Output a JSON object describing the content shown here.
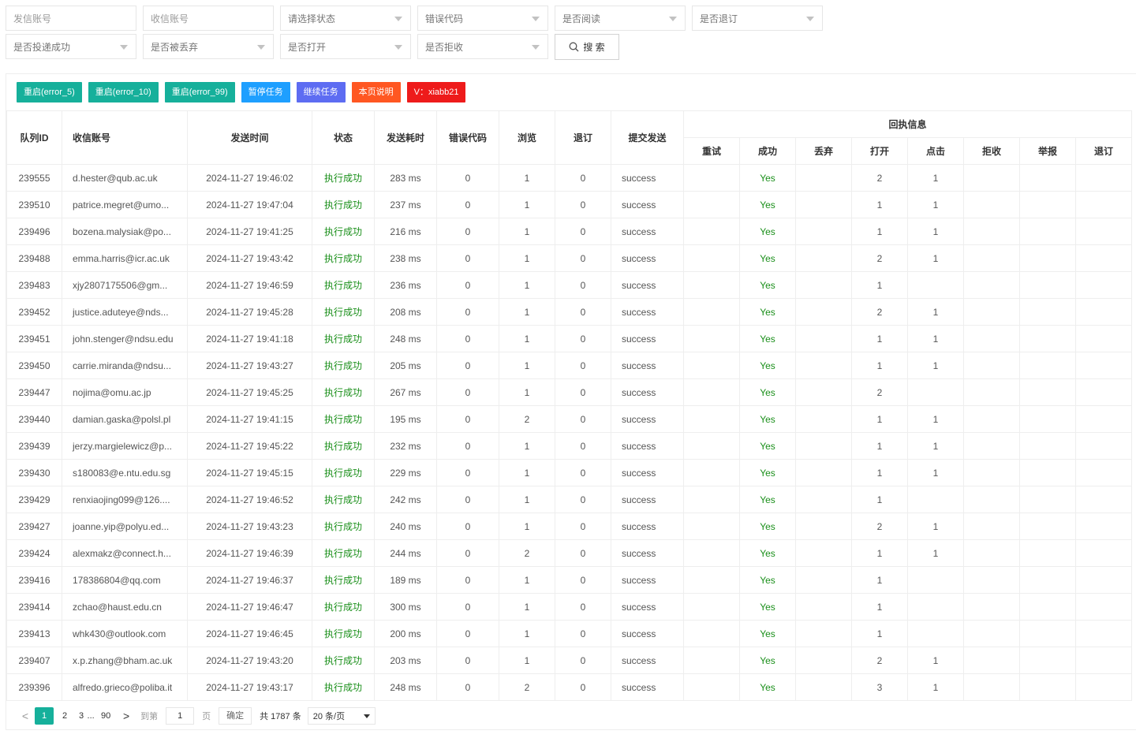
{
  "filters": {
    "row1": [
      {
        "name": "sender-account-input",
        "label": "发信账号",
        "type": "input"
      },
      {
        "name": "recipient-account-input",
        "label": "收信账号",
        "type": "input"
      },
      {
        "name": "status-select",
        "label": "请选择状态",
        "type": "select"
      },
      {
        "name": "error-code-select",
        "label": "错误代码",
        "type": "select"
      },
      {
        "name": "read-select",
        "label": "是否阅读",
        "type": "select"
      },
      {
        "name": "unsubscribe-select",
        "label": "是否退订",
        "type": "select"
      }
    ],
    "row2": [
      {
        "name": "delivered-select",
        "label": "是否投递成功",
        "type": "select"
      },
      {
        "name": "discarded-select",
        "label": "是否被丢弃",
        "type": "select"
      },
      {
        "name": "opened-select",
        "label": "是否打开",
        "type": "select"
      },
      {
        "name": "rejected-select",
        "label": "是否拒收",
        "type": "select"
      }
    ],
    "search_label": "搜 索"
  },
  "toolbar": {
    "retry5": "重启(error_5)",
    "retry10": "重启(error_10)",
    "retry99": "重启(error_99)",
    "pause": "暂停任务",
    "resume": "继续任务",
    "help": "本页说明",
    "contact": "V：xiabb21"
  },
  "table": {
    "headers": {
      "id": "队列ID",
      "recipient": "收信账号",
      "time": "发送时间",
      "status": "状态",
      "duration": "发送耗时",
      "error": "错误代码",
      "views": "浏览",
      "unsub": "退订",
      "submit": "提交发送",
      "receipt": "回执信息",
      "retry": "重试",
      "success": "成功",
      "discard": "丢弃",
      "open": "打开",
      "click": "点击",
      "reject": "拒收",
      "report": "举报",
      "unsub2": "退订"
    },
    "rows": [
      {
        "id": "239555",
        "recipient": "d.hester@qub.ac.uk",
        "time": "2024-11-27 19:46:02",
        "status": "执行成功",
        "duration": "283 ms",
        "error": "0",
        "views": "1",
        "unsub": "0",
        "submit": "success",
        "retry": "",
        "success": "Yes",
        "discard": "",
        "open": "2",
        "click": "1",
        "reject": "",
        "report": "",
        "unsub2": ""
      },
      {
        "id": "239510",
        "recipient": "patrice.megret@umo...",
        "time": "2024-11-27 19:47:04",
        "status": "执行成功",
        "duration": "237 ms",
        "error": "0",
        "views": "1",
        "unsub": "0",
        "submit": "success",
        "retry": "",
        "success": "Yes",
        "discard": "",
        "open": "1",
        "click": "1",
        "reject": "",
        "report": "",
        "unsub2": ""
      },
      {
        "id": "239496",
        "recipient": "bozena.malysiak@po...",
        "time": "2024-11-27 19:41:25",
        "status": "执行成功",
        "duration": "216 ms",
        "error": "0",
        "views": "1",
        "unsub": "0",
        "submit": "success",
        "retry": "",
        "success": "Yes",
        "discard": "",
        "open": "1",
        "click": "1",
        "reject": "",
        "report": "",
        "unsub2": ""
      },
      {
        "id": "239488",
        "recipient": "emma.harris@icr.ac.uk",
        "time": "2024-11-27 19:43:42",
        "status": "执行成功",
        "duration": "238 ms",
        "error": "0",
        "views": "1",
        "unsub": "0",
        "submit": "success",
        "retry": "",
        "success": "Yes",
        "discard": "",
        "open": "2",
        "click": "1",
        "reject": "",
        "report": "",
        "unsub2": ""
      },
      {
        "id": "239483",
        "recipient": "xjy2807175506@gm...",
        "time": "2024-11-27 19:46:59",
        "status": "执行成功",
        "duration": "236 ms",
        "error": "0",
        "views": "1",
        "unsub": "0",
        "submit": "success",
        "retry": "",
        "success": "Yes",
        "discard": "",
        "open": "1",
        "click": "",
        "reject": "",
        "report": "",
        "unsub2": ""
      },
      {
        "id": "239452",
        "recipient": "justice.aduteye@nds...",
        "time": "2024-11-27 19:45:28",
        "status": "执行成功",
        "duration": "208 ms",
        "error": "0",
        "views": "1",
        "unsub": "0",
        "submit": "success",
        "retry": "",
        "success": "Yes",
        "discard": "",
        "open": "2",
        "click": "1",
        "reject": "",
        "report": "",
        "unsub2": ""
      },
      {
        "id": "239451",
        "recipient": "john.stenger@ndsu.edu",
        "time": "2024-11-27 19:41:18",
        "status": "执行成功",
        "duration": "248 ms",
        "error": "0",
        "views": "1",
        "unsub": "0",
        "submit": "success",
        "retry": "",
        "success": "Yes",
        "discard": "",
        "open": "1",
        "click": "1",
        "reject": "",
        "report": "",
        "unsub2": ""
      },
      {
        "id": "239450",
        "recipient": "carrie.miranda@ndsu...",
        "time": "2024-11-27 19:43:27",
        "status": "执行成功",
        "duration": "205 ms",
        "error": "0",
        "views": "1",
        "unsub": "0",
        "submit": "success",
        "retry": "",
        "success": "Yes",
        "discard": "",
        "open": "1",
        "click": "1",
        "reject": "",
        "report": "",
        "unsub2": ""
      },
      {
        "id": "239447",
        "recipient": "nojima@omu.ac.jp",
        "time": "2024-11-27 19:45:25",
        "status": "执行成功",
        "duration": "267 ms",
        "error": "0",
        "views": "1",
        "unsub": "0",
        "submit": "success",
        "retry": "",
        "success": "Yes",
        "discard": "",
        "open": "2",
        "click": "",
        "reject": "",
        "report": "",
        "unsub2": ""
      },
      {
        "id": "239440",
        "recipient": "damian.gaska@polsl.pl",
        "time": "2024-11-27 19:41:15",
        "status": "执行成功",
        "duration": "195 ms",
        "error": "0",
        "views": "2",
        "unsub": "0",
        "submit": "success",
        "retry": "",
        "success": "Yes",
        "discard": "",
        "open": "1",
        "click": "1",
        "reject": "",
        "report": "",
        "unsub2": ""
      },
      {
        "id": "239439",
        "recipient": "jerzy.margielewicz@p...",
        "time": "2024-11-27 19:45:22",
        "status": "执行成功",
        "duration": "232 ms",
        "error": "0",
        "views": "1",
        "unsub": "0",
        "submit": "success",
        "retry": "",
        "success": "Yes",
        "discard": "",
        "open": "1",
        "click": "1",
        "reject": "",
        "report": "",
        "unsub2": ""
      },
      {
        "id": "239430",
        "recipient": "s180083@e.ntu.edu.sg",
        "time": "2024-11-27 19:45:15",
        "status": "执行成功",
        "duration": "229 ms",
        "error": "0",
        "views": "1",
        "unsub": "0",
        "submit": "success",
        "retry": "",
        "success": "Yes",
        "discard": "",
        "open": "1",
        "click": "1",
        "reject": "",
        "report": "",
        "unsub2": ""
      },
      {
        "id": "239429",
        "recipient": "renxiaojing099@126....",
        "time": "2024-11-27 19:46:52",
        "status": "执行成功",
        "duration": "242 ms",
        "error": "0",
        "views": "1",
        "unsub": "0",
        "submit": "success",
        "retry": "",
        "success": "Yes",
        "discard": "",
        "open": "1",
        "click": "",
        "reject": "",
        "report": "",
        "unsub2": ""
      },
      {
        "id": "239427",
        "recipient": "joanne.yip@polyu.ed...",
        "time": "2024-11-27 19:43:23",
        "status": "执行成功",
        "duration": "240 ms",
        "error": "0",
        "views": "1",
        "unsub": "0",
        "submit": "success",
        "retry": "",
        "success": "Yes",
        "discard": "",
        "open": "2",
        "click": "1",
        "reject": "",
        "report": "",
        "unsub2": ""
      },
      {
        "id": "239424",
        "recipient": "alexmakz@connect.h...",
        "time": "2024-11-27 19:46:39",
        "status": "执行成功",
        "duration": "244 ms",
        "error": "0",
        "views": "2",
        "unsub": "0",
        "submit": "success",
        "retry": "",
        "success": "Yes",
        "discard": "",
        "open": "1",
        "click": "1",
        "reject": "",
        "report": "",
        "unsub2": ""
      },
      {
        "id": "239416",
        "recipient": "178386804@qq.com",
        "time": "2024-11-27 19:46:37",
        "status": "执行成功",
        "duration": "189 ms",
        "error": "0",
        "views": "1",
        "unsub": "0",
        "submit": "success",
        "retry": "",
        "success": "Yes",
        "discard": "",
        "open": "1",
        "click": "",
        "reject": "",
        "report": "",
        "unsub2": ""
      },
      {
        "id": "239414",
        "recipient": "zchao@haust.edu.cn",
        "time": "2024-11-27 19:46:47",
        "status": "执行成功",
        "duration": "300 ms",
        "error": "0",
        "views": "1",
        "unsub": "0",
        "submit": "success",
        "retry": "",
        "success": "Yes",
        "discard": "",
        "open": "1",
        "click": "",
        "reject": "",
        "report": "",
        "unsub2": ""
      },
      {
        "id": "239413",
        "recipient": "whk430@outlook.com",
        "time": "2024-11-27 19:46:45",
        "status": "执行成功",
        "duration": "200 ms",
        "error": "0",
        "views": "1",
        "unsub": "0",
        "submit": "success",
        "retry": "",
        "success": "Yes",
        "discard": "",
        "open": "1",
        "click": "",
        "reject": "",
        "report": "",
        "unsub2": ""
      },
      {
        "id": "239407",
        "recipient": "x.p.zhang@bham.ac.uk",
        "time": "2024-11-27 19:43:20",
        "status": "执行成功",
        "duration": "203 ms",
        "error": "0",
        "views": "1",
        "unsub": "0",
        "submit": "success",
        "retry": "",
        "success": "Yes",
        "discard": "",
        "open": "2",
        "click": "1",
        "reject": "",
        "report": "",
        "unsub2": ""
      },
      {
        "id": "239396",
        "recipient": "alfredo.grieco@poliba.it",
        "time": "2024-11-27 19:43:17",
        "status": "执行成功",
        "duration": "248 ms",
        "error": "0",
        "views": "2",
        "unsub": "0",
        "submit": "success",
        "retry": "",
        "success": "Yes",
        "discard": "",
        "open": "3",
        "click": "1",
        "reject": "",
        "report": "",
        "unsub2": ""
      }
    ]
  },
  "pager": {
    "prev": "<",
    "pages": [
      "1",
      "2",
      "3"
    ],
    "ellipsis": "...",
    "last": "90",
    "next": ">",
    "goto_label": "到第",
    "goto_value": "1",
    "page_unit": "页",
    "confirm": "确定",
    "total": "共 1787 条",
    "per_page": "20 条/页"
  },
  "colors": {
    "teal": "#16b09b",
    "blue": "#1e9fff",
    "indigo": "#5d6cf2",
    "orange": "#ff5722",
    "red": "#ee1b1b",
    "success_text": "#1a8f1a"
  }
}
